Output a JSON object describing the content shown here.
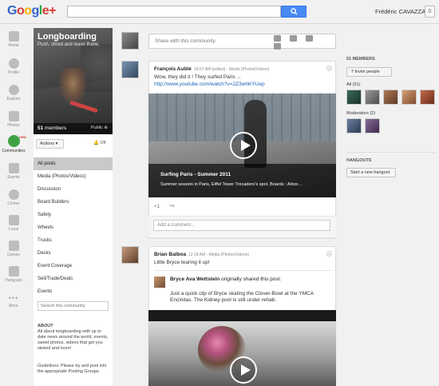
{
  "topbar": {
    "logo": "Google+",
    "search_placeholder": "",
    "user_name": "Frédéric CAVAZZA",
    "notifications_count": "0"
  },
  "leftnav": {
    "items": [
      {
        "label": "Home",
        "icon": "home-icon"
      },
      {
        "label": "Profile",
        "icon": "profile-icon"
      },
      {
        "label": "Explore",
        "icon": "explore-icon"
      },
      {
        "label": "Photos",
        "icon": "camera-icon"
      },
      {
        "label": "Communities",
        "icon": "communities-icon",
        "badge": "new"
      },
      {
        "label": "Events",
        "icon": "events-icon"
      },
      {
        "label": "Circles",
        "icon": "circles-icon"
      },
      {
        "label": "Local",
        "icon": "local-icon"
      },
      {
        "label": "Games",
        "icon": "games-icon"
      },
      {
        "label": "Hangouts",
        "icon": "hangouts-icon"
      },
      {
        "label": "More",
        "icon": "more-icon"
      }
    ]
  },
  "community": {
    "name": "Longboarding",
    "tagline": "Push, shred and leave thane.",
    "members_number": "51",
    "members_word": "members",
    "visibility": "Public",
    "actions_label": "Actions",
    "notify_label": "Off",
    "categories": [
      "All posts",
      "Media (Photos/Videos)",
      "Discussion",
      "Board Builders",
      "Safety",
      "Wheels",
      "Trucks",
      "Decks",
      "Event Coverage",
      "Sell/Trade/Deals",
      "Events"
    ],
    "active_category": "All posts",
    "search_placeholder": "Search this community",
    "about_title": "ABOUT",
    "about_text": "All about longboarding with up to date news around the world, events, sweet photos, videos that get you stoked and more!",
    "guidelines": "Guidelines: Please try and post into the appropriate Posting Groups."
  },
  "share": {
    "placeholder": "Share with this community"
  },
  "posts": [
    {
      "author": "François Aublé",
      "time": "10:57 AM (edited)",
      "category": "Media (Photos/Videos)",
      "text": "Wow, they did it ! They surfed Paris ...",
      "link": "http://www.youtube.com/watch?v=2Z3whKYUep",
      "video_title": "Surfing Paris - Summer 2011",
      "video_desc": "Summer session in Paris, Eiffel Tower Trocadero's spot. Boards : Arbor...",
      "plus_one": "+1",
      "comment_placeholder": "Add a comment..."
    },
    {
      "author": "Brian Balboa",
      "time": "12:18 AM",
      "category": "Media (Photos/Videos)",
      "text": "Little Bryce tearing it up!",
      "original_author": "Bryce Ava Wettstein",
      "original_suffix": "originally shared this post:",
      "original_text": "Just a quick clip of Bryce skating the Clover-Bowl at the YMCA Encinitas. The Kidney pool is still under rehab."
    }
  ],
  "sidebar": {
    "members_heading": "51 MEMBERS",
    "invite_label": "Invite people",
    "all_label": "All (51)",
    "moderators_label": "Moderators (2)",
    "hangouts_heading": "HANGOUTS",
    "hangout_button": "Start a new hangout"
  },
  "colors": {
    "accent_blue": "#4a8af4",
    "link_blue": "#1a5fb4",
    "active_green": "#3fa344",
    "new_badge_red": "#d14836"
  }
}
